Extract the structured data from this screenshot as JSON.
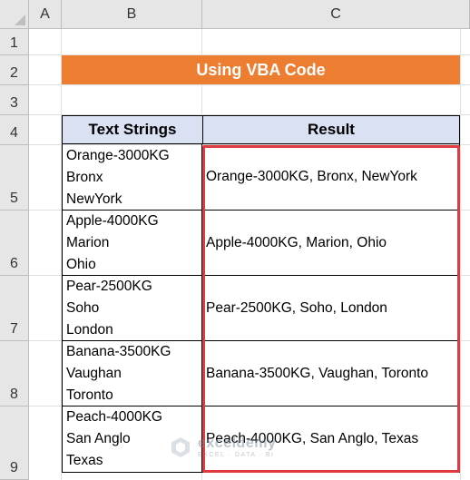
{
  "sheet": {
    "columns": [
      "A",
      "B",
      "C"
    ],
    "rows": [
      "1",
      "2",
      "3",
      "4",
      "5",
      "6",
      "7",
      "8",
      "9"
    ]
  },
  "title": "Using VBA Code",
  "table": {
    "headers": [
      "Text Strings",
      "Result"
    ],
    "rows": [
      {
        "lines": [
          "Orange-3000KG",
          "Bronx",
          "NewYork"
        ],
        "result": "Orange-3000KG, Bronx, NewYork"
      },
      {
        "lines": [
          "Apple-4000KG",
          "Marion",
          "Ohio"
        ],
        "result": "Apple-4000KG, Marion, Ohio"
      },
      {
        "lines": [
          "Pear-2500KG",
          "Soho",
          "London"
        ],
        "result": "Pear-2500KG, Soho, London"
      },
      {
        "lines": [
          "Banana-3500KG",
          "Vaughan",
          "Toronto"
        ],
        "result": "Banana-3500KG, Vaughan, Toronto"
      },
      {
        "lines": [
          "Peach-4000KG",
          "San Anglo",
          "Texas"
        ],
        "result": "Peach-4000KG, San Anglo, Texas"
      }
    ]
  },
  "watermark": {
    "name": "exceldemy",
    "tagline": "EXCEL · DATA · BI"
  },
  "colors": {
    "title_bg": "#ed7d31",
    "header_bg": "#dae1f3",
    "highlight_border": "#e0393e"
  }
}
